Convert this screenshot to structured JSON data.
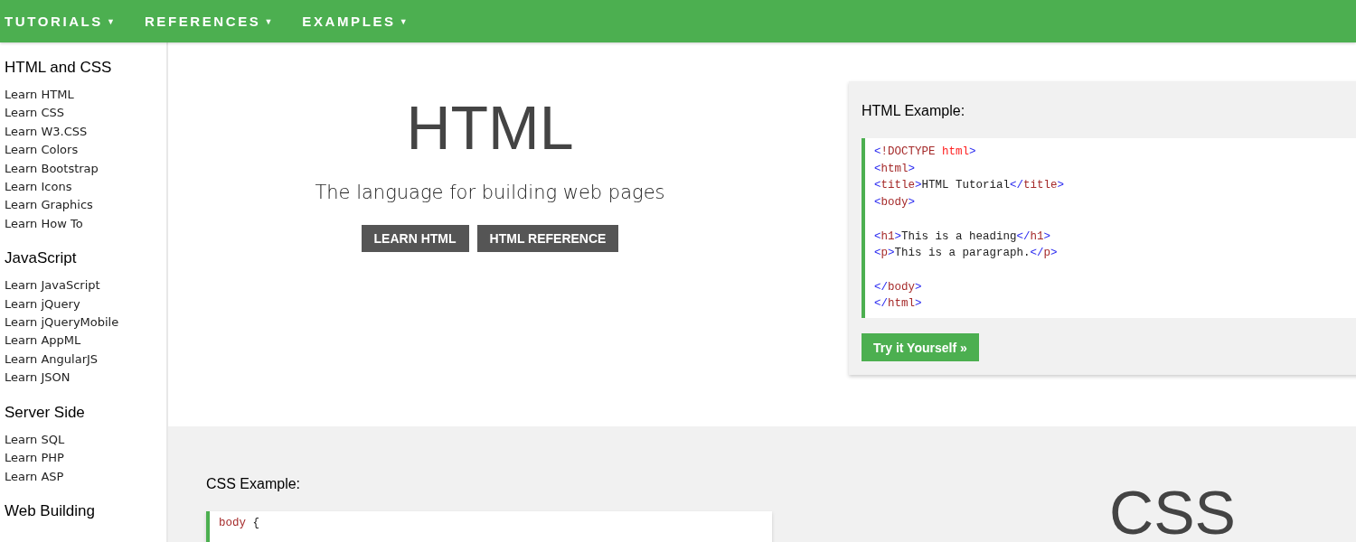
{
  "nav": [
    {
      "label": "TUTORIALS",
      "caret": "▼"
    },
    {
      "label": "REFERENCES",
      "caret": "▼"
    },
    {
      "label": "EXAMPLES",
      "caret": "▼"
    }
  ],
  "sidebar": {
    "sections": [
      {
        "heading": "HTML and CSS",
        "items": [
          "Learn HTML",
          "Learn CSS",
          "Learn W3.CSS",
          "Learn Colors",
          "Learn Bootstrap",
          "Learn Icons",
          "Learn Graphics",
          "Learn How To"
        ]
      },
      {
        "heading": "JavaScript",
        "items": [
          "Learn JavaScript",
          "Learn jQuery",
          "Learn jQueryMobile",
          "Learn AppML",
          "Learn AngularJS",
          "Learn JSON"
        ]
      },
      {
        "heading": "Server Side",
        "items": [
          "Learn SQL",
          "Learn PHP",
          "Learn ASP"
        ]
      },
      {
        "heading": "Web Building"
      }
    ]
  },
  "html_hero": {
    "title": "HTML",
    "subtitle": "The language for building web pages",
    "buttons": [
      "LEARN HTML",
      "HTML REFERENCE"
    ]
  },
  "html_example": {
    "heading": "HTML Example:",
    "lines": [
      {
        "kind": "code",
        "tokens": [
          {
            "kind": "bracket",
            "text": "<"
          },
          {
            "kind": "tag",
            "text": "!DOCTYPE"
          },
          {
            "kind": "attr",
            "text": " html"
          },
          {
            "kind": "bracket",
            "text": ">"
          }
        ]
      },
      {
        "kind": "code",
        "tokens": [
          {
            "kind": "bracket",
            "text": "<"
          },
          {
            "kind": "tag",
            "text": "html"
          },
          {
            "kind": "bracket",
            "text": ">"
          }
        ]
      },
      {
        "kind": "code",
        "tokens": [
          {
            "kind": "bracket",
            "text": "<"
          },
          {
            "kind": "tag",
            "text": "title"
          },
          {
            "kind": "bracket",
            "text": ">"
          },
          {
            "kind": "text",
            "text": "HTML Tutorial"
          },
          {
            "kind": "bracket",
            "text": "</"
          },
          {
            "kind": "tag",
            "text": "title"
          },
          {
            "kind": "bracket",
            "text": ">"
          }
        ]
      },
      {
        "kind": "code",
        "tokens": [
          {
            "kind": "bracket",
            "text": "<"
          },
          {
            "kind": "tag",
            "text": "body"
          },
          {
            "kind": "bracket",
            "text": ">"
          }
        ]
      },
      {
        "kind": "blank"
      },
      {
        "kind": "code",
        "tokens": [
          {
            "kind": "bracket",
            "text": "<"
          },
          {
            "kind": "tag",
            "text": "h1"
          },
          {
            "kind": "bracket",
            "text": ">"
          },
          {
            "kind": "text",
            "text": "This is a heading"
          },
          {
            "kind": "bracket",
            "text": "</"
          },
          {
            "kind": "tag",
            "text": "h1"
          },
          {
            "kind": "bracket",
            "text": ">"
          }
        ]
      },
      {
        "kind": "code",
        "tokens": [
          {
            "kind": "bracket",
            "text": "<"
          },
          {
            "kind": "tag",
            "text": "p"
          },
          {
            "kind": "bracket",
            "text": ">"
          },
          {
            "kind": "text",
            "text": "This is a paragraph."
          },
          {
            "kind": "bracket",
            "text": "</"
          },
          {
            "kind": "tag",
            "text": "p"
          },
          {
            "kind": "bracket",
            "text": ">"
          }
        ]
      },
      {
        "kind": "blank"
      },
      {
        "kind": "code",
        "tokens": [
          {
            "kind": "bracket",
            "text": "</"
          },
          {
            "kind": "tag",
            "text": "body"
          },
          {
            "kind": "bracket",
            "text": ">"
          }
        ]
      },
      {
        "kind": "code",
        "tokens": [
          {
            "kind": "bracket",
            "text": "</"
          },
          {
            "kind": "tag",
            "text": "html"
          },
          {
            "kind": "bracket",
            "text": ">"
          }
        ]
      }
    ],
    "button": "Try it Yourself »"
  },
  "css_example": {
    "heading": "CSS Example:",
    "lines": [
      {
        "kind": "code",
        "tokens": [
          {
            "kind": "tag",
            "text": "body"
          },
          {
            "kind": "text",
            "text": " {"
          }
        ]
      }
    ]
  },
  "css_hero": {
    "title": "CSS"
  }
}
